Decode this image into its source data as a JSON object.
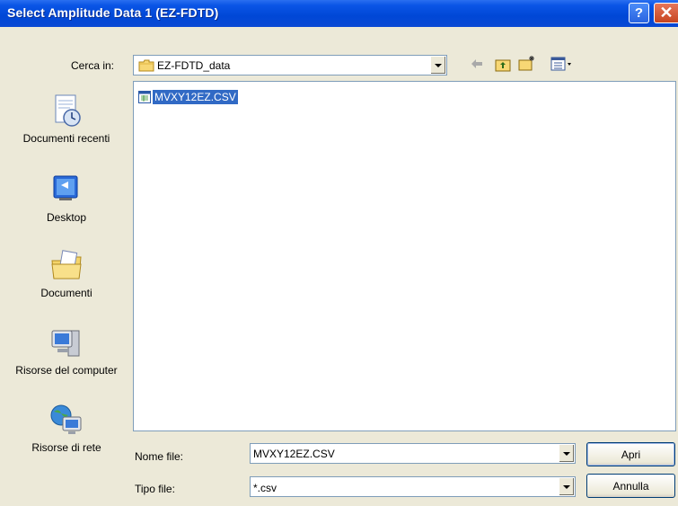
{
  "window": {
    "title": "Select Amplitude Data 1 (EZ-FDTD)",
    "help_label": "?",
    "close_label": "✕"
  },
  "look_in": {
    "label": "Cerca in:",
    "value": "EZ-FDTD_data"
  },
  "toolbar_icons": [
    "back-arrow-icon",
    "up-folder-icon",
    "new-folder-icon",
    "view-menu-icon"
  ],
  "places": [
    {
      "name": "documenti-recenti",
      "label": "Documenti recenti",
      "icon": "recent-documents-icon"
    },
    {
      "name": "desktop",
      "label": "Desktop",
      "icon": "desktop-icon"
    },
    {
      "name": "documenti",
      "label": "Documenti",
      "icon": "my-documents-icon"
    },
    {
      "name": "risorse-computer",
      "label": "Risorse del computer",
      "icon": "my-computer-icon"
    },
    {
      "name": "risorse-rete",
      "label": "Risorse di rete",
      "icon": "network-places-icon"
    }
  ],
  "files": [
    {
      "name": "MVXY12EZ.CSV",
      "selected": true
    }
  ],
  "file_name": {
    "label": "Nome file:",
    "value": "MVXY12EZ.CSV"
  },
  "file_type": {
    "label": "Tipo file:",
    "value": "*.csv"
  },
  "buttons": {
    "open": "Apri",
    "cancel": "Annulla"
  },
  "colors": {
    "title_bar": "#0047d6",
    "selection": "#316ac5",
    "dialog_bg": "#ece9d8"
  }
}
